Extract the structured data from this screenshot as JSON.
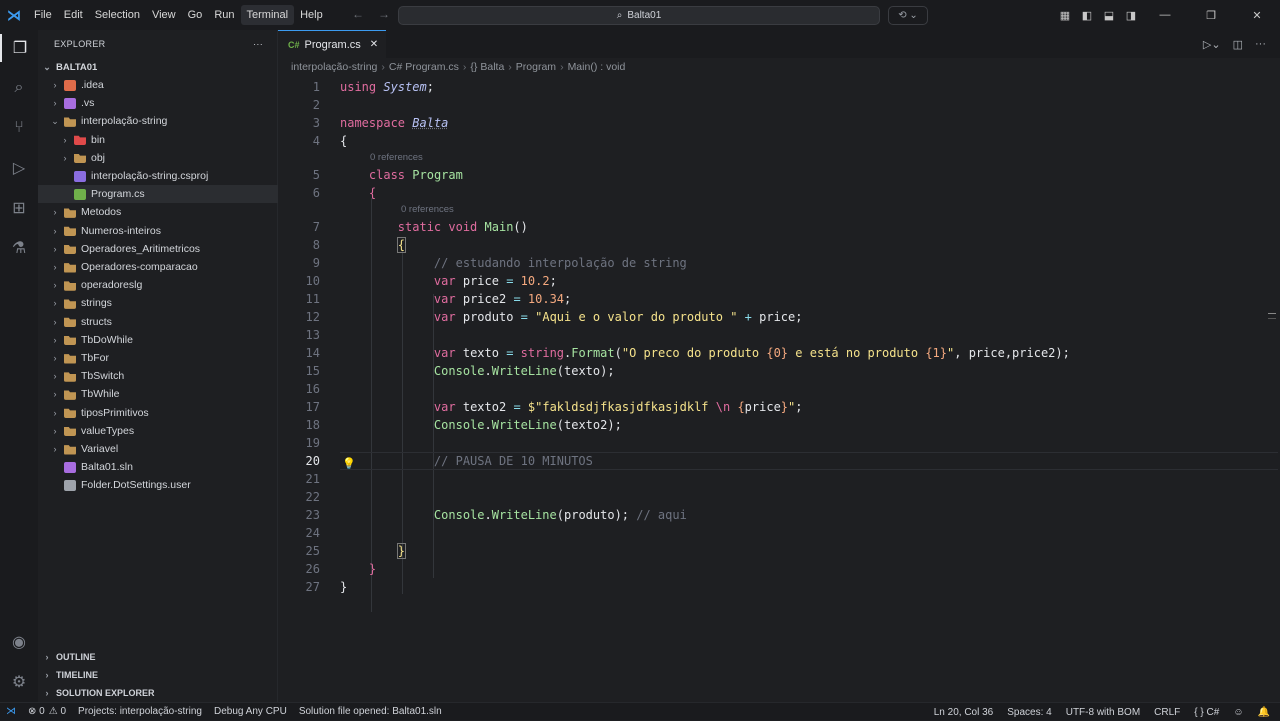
{
  "app": {
    "title": "Balta01",
    "logo_icon": "vscode-icon",
    "accent": "#3c9bf0"
  },
  "menu": [
    "File",
    "Edit",
    "Selection",
    "View",
    "Go",
    "Run",
    "Terminal",
    "Help"
  ],
  "explorer": {
    "header": "EXPLORER",
    "root": "BALTA01",
    "items": [
      {
        "label": ".idea",
        "indent": 1,
        "chev": "›",
        "icon": "idea-icon",
        "color": "#e06c4a"
      },
      {
        "label": ".vs",
        "indent": 1,
        "chev": "›",
        "icon": "vs-icon",
        "color": "#a86de0"
      },
      {
        "label": "interpolação-string",
        "indent": 1,
        "chev": "⌄",
        "icon": "folder-open-icon",
        "color": "#c09553"
      },
      {
        "label": "bin",
        "indent": 2,
        "chev": "›",
        "icon": "bin-folder-icon",
        "color": "#e04a4a"
      },
      {
        "label": "obj",
        "indent": 2,
        "chev": "›",
        "icon": "folder-icon",
        "color": "#c09553"
      },
      {
        "label": "interpolação-string.csproj",
        "indent": 2,
        "chev": "",
        "icon": "csproj-icon",
        "color": "#8a6de0"
      },
      {
        "label": "Program.cs",
        "indent": 2,
        "chev": "",
        "icon": "csharp-icon",
        "color": "#6fb04a",
        "selected": true
      },
      {
        "label": "Metodos",
        "indent": 1,
        "chev": "›",
        "icon": "folder-icon",
        "color": "#c09553"
      },
      {
        "label": "Numeros-inteiros",
        "indent": 1,
        "chev": "›",
        "icon": "folder-icon",
        "color": "#c09553"
      },
      {
        "label": "Operadores_Aritimetricos",
        "indent": 1,
        "chev": "›",
        "icon": "folder-icon",
        "color": "#c09553"
      },
      {
        "label": "Operadores-comparacao",
        "indent": 1,
        "chev": "›",
        "icon": "folder-icon",
        "color": "#c09553"
      },
      {
        "label": "operadoreslg",
        "indent": 1,
        "chev": "›",
        "icon": "folder-icon",
        "color": "#c09553"
      },
      {
        "label": "strings",
        "indent": 1,
        "chev": "›",
        "icon": "folder-icon",
        "color": "#c09553"
      },
      {
        "label": "structs",
        "indent": 1,
        "chev": "›",
        "icon": "folder-icon",
        "color": "#c09553"
      },
      {
        "label": "TbDoWhile",
        "indent": 1,
        "chev": "›",
        "icon": "folder-icon",
        "color": "#c09553"
      },
      {
        "label": "TbFor",
        "indent": 1,
        "chev": "›",
        "icon": "folder-icon",
        "color": "#c09553"
      },
      {
        "label": "TbSwitch",
        "indent": 1,
        "chev": "›",
        "icon": "folder-icon",
        "color": "#c09553"
      },
      {
        "label": "TbWhile",
        "indent": 1,
        "chev": "›",
        "icon": "folder-icon",
        "color": "#c09553"
      },
      {
        "label": "tiposPrimitivos",
        "indent": 1,
        "chev": "›",
        "icon": "folder-icon",
        "color": "#c09553"
      },
      {
        "label": "valueTypes",
        "indent": 1,
        "chev": "›",
        "icon": "folder-icon",
        "color": "#c09553"
      },
      {
        "label": "Variavel",
        "indent": 1,
        "chev": "›",
        "icon": "folder-icon",
        "color": "#c09553"
      },
      {
        "label": "Balta01.sln",
        "indent": 1,
        "chev": "",
        "icon": "sln-icon",
        "color": "#a86de0"
      },
      {
        "label": "Folder.DotSettings.user",
        "indent": 1,
        "chev": "",
        "icon": "file-icon",
        "color": "#9ea3ab"
      }
    ],
    "panels": [
      "OUTLINE",
      "TIMELINE",
      "SOLUTION EXPLORER"
    ]
  },
  "tab": {
    "label": "Program.cs",
    "lang": "C#"
  },
  "breadcrumb": [
    "interpolação-string",
    "C# Program.cs",
    "{} Balta",
    "Program",
    "Main() : void"
  ],
  "codelens": "0 references",
  "status": {
    "left": [
      "⊗ 0",
      "⚠ 0",
      "Projects: interpolação-string",
      "Debug Any CPU",
      "Solution file opened: Balta01.sln"
    ],
    "right": [
      "Ln 20, Col 36",
      "Spaces: 4",
      "UTF-8 with BOM",
      "CRLF",
      "{ } C#"
    ]
  }
}
